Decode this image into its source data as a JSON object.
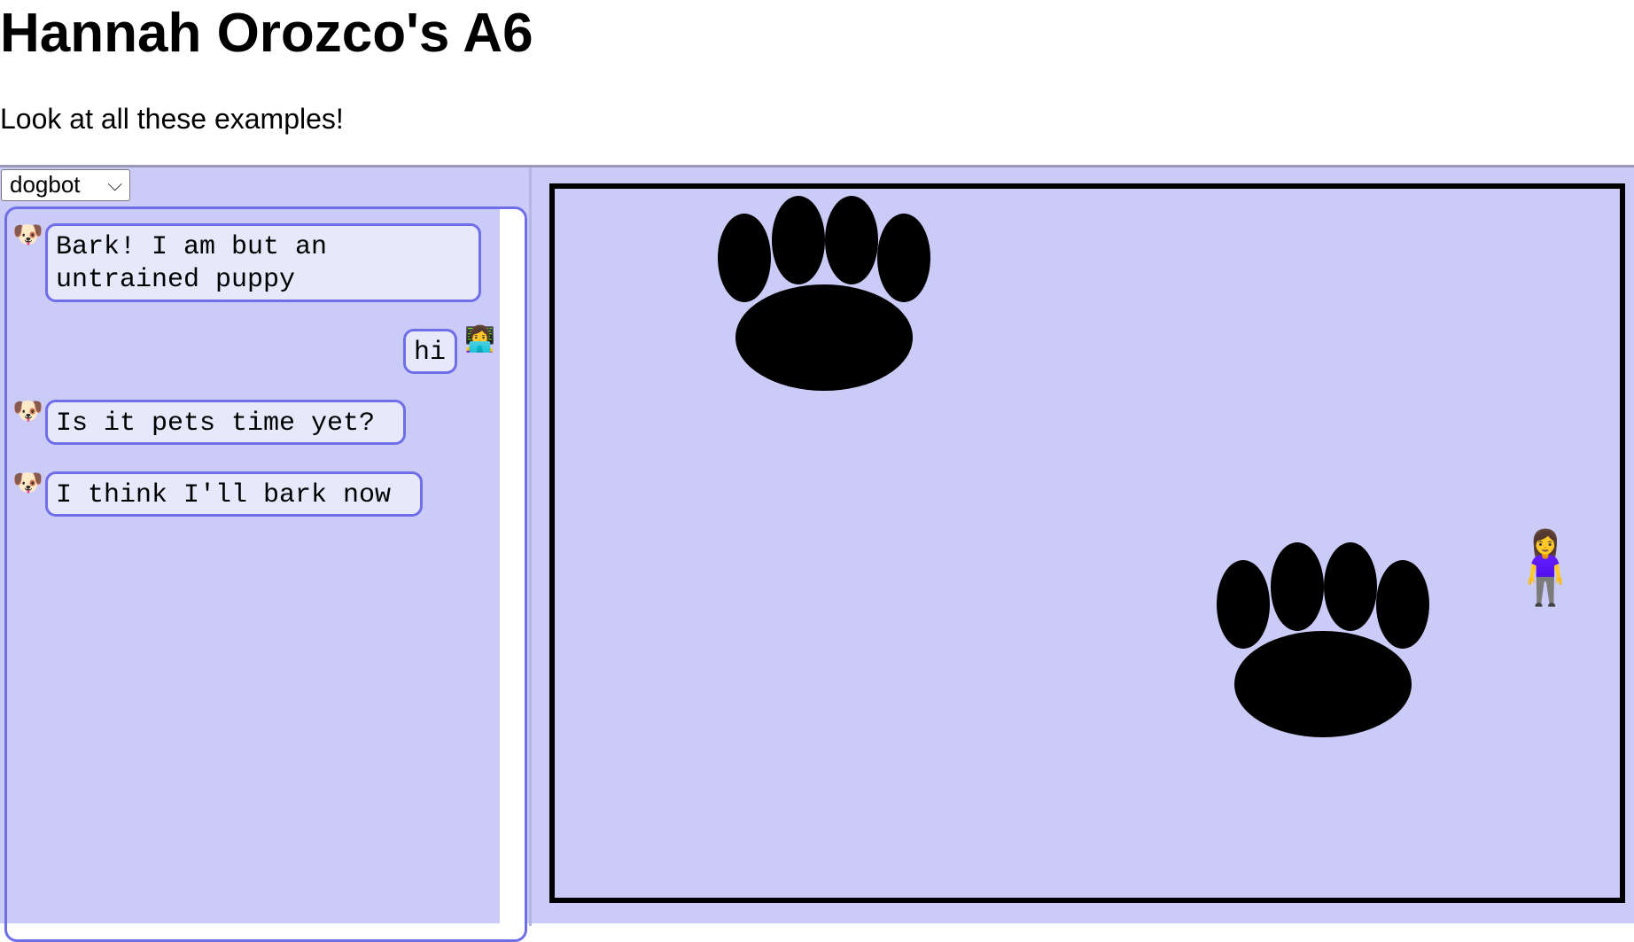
{
  "header": {
    "title": "Hannah Orozco's A6",
    "subtitle": "Look at all these examples!"
  },
  "bot_selector": {
    "selected": "dogbot",
    "chevron_icon": "chevron-down-icon"
  },
  "chat": {
    "messages": [
      {
        "sender": "bot",
        "avatar_icon": "dog-face-icon",
        "avatar_glyph": "🐶",
        "text": "Bark! I am but an\nuntrained puppy"
      },
      {
        "sender": "user",
        "avatar_icon": "technologist-icon",
        "avatar_glyph": "👩‍💻",
        "text": "hi"
      },
      {
        "sender": "bot",
        "avatar_icon": "dog-face-icon",
        "avatar_glyph": "🐶",
        "text": "Is it pets time yet?"
      },
      {
        "sender": "bot",
        "avatar_icon": "dog-face-icon",
        "avatar_glyph": "🐶",
        "text": "I think I'll bark now"
      }
    ]
  },
  "canvas": {
    "background_color": "#cbcbf7",
    "paw_color": "#000000",
    "paw_prints": [
      "paw-print-icon",
      "paw-print-icon"
    ],
    "character_icon": "woman-standing-icon",
    "character_glyph": "🧍‍♀️"
  }
}
